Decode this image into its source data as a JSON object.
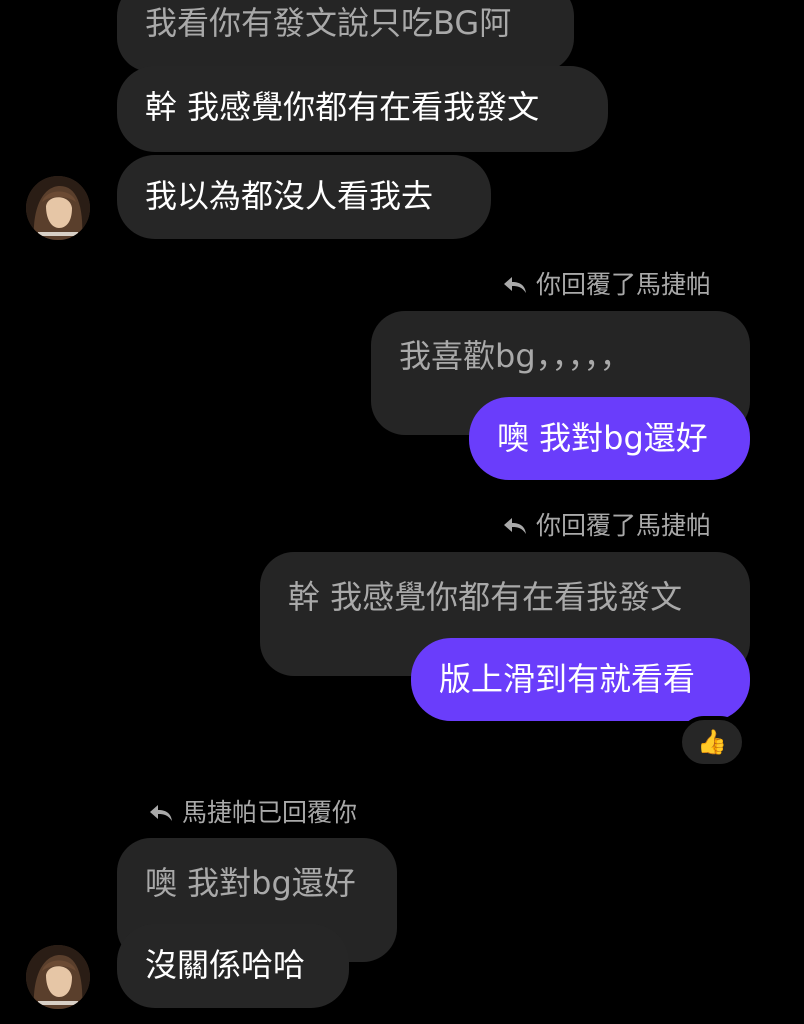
{
  "thread": {
    "msg1_text": "我看你有發文說只吃BG阿",
    "msg2_text": "幹 我感覺你都有在看我發文",
    "msg3_text": "我以為都沒人看我去",
    "reply1": {
      "label": "你回覆了馬捷帕",
      "quoted_text": "我喜歡bg，，，，，",
      "reply_text": "噢 我對bg還好"
    },
    "reply2": {
      "label": "你回覆了馬捷帕",
      "quoted_text": "幹 我感覺你都有在看我發文",
      "reply_text": "版上滑到有就看看",
      "reaction_emoji": "👍"
    },
    "reply3": {
      "label": "馬捷帕已回覆你",
      "quoted_text": "噢 我對bg還好",
      "reply_text": "沒關係哈哈"
    }
  },
  "colors": {
    "background": "#000000",
    "incoming_bubble": "#262626",
    "outgoing_bubble": "#6a3dfb",
    "secondary_text": "#a9a9a9"
  },
  "icons": {
    "reply": "reply-arrow-icon",
    "avatar": "contact-avatar"
  }
}
